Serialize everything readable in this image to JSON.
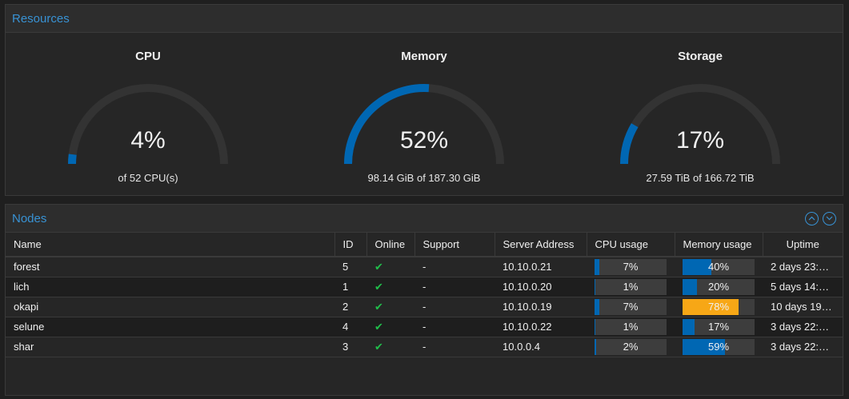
{
  "colors": {
    "accent": "#3892d4",
    "gauge_fill": "#0067b3",
    "gauge_track": "#333333",
    "bar_warn": "#f7a716",
    "online_check": "#21bf4b"
  },
  "resources": {
    "title": "Resources",
    "gauges": [
      {
        "title": "CPU",
        "value": 4,
        "value_label": "4%",
        "sub": "of 52 CPU(s)"
      },
      {
        "title": "Memory",
        "value": 52,
        "value_label": "52%",
        "sub": "98.14 GiB of 187.30 GiB"
      },
      {
        "title": "Storage",
        "value": 17,
        "value_label": "17%",
        "sub": "27.59 TiB of 166.72 TiB"
      }
    ]
  },
  "nodes": {
    "title": "Nodes",
    "tools": {
      "collapse_icon": "chevron-up-circle-icon",
      "expand_icon": "chevron-down-circle-icon"
    },
    "columns": [
      "Name",
      "ID",
      "Online",
      "Support",
      "Server Address",
      "CPU usage",
      "Memory usage",
      "Uptime"
    ],
    "rows": [
      {
        "name": "forest",
        "id": "5",
        "online": "✔",
        "support": "-",
        "address": "10.10.0.21",
        "cpu": 7,
        "cpu_label": "7%",
        "mem": 40,
        "mem_label": "40%",
        "uptime": "2 days 23:…"
      },
      {
        "name": "lich",
        "id": "1",
        "online": "✔",
        "support": "-",
        "address": "10.10.0.20",
        "cpu": 1,
        "cpu_label": "1%",
        "mem": 20,
        "mem_label": "20%",
        "uptime": "5 days 14:…"
      },
      {
        "name": "okapi",
        "id": "2",
        "online": "✔",
        "support": "-",
        "address": "10.10.0.19",
        "cpu": 7,
        "cpu_label": "7%",
        "mem": 78,
        "mem_label": "78%",
        "uptime": "10 days 19…"
      },
      {
        "name": "selune",
        "id": "4",
        "online": "✔",
        "support": "-",
        "address": "10.10.0.22",
        "cpu": 1,
        "cpu_label": "1%",
        "mem": 17,
        "mem_label": "17%",
        "uptime": "3 days 22:…"
      },
      {
        "name": "shar",
        "id": "3",
        "online": "✔",
        "support": "-",
        "address": "10.0.0.4",
        "cpu": 2,
        "cpu_label": "2%",
        "mem": 59,
        "mem_label": "59%",
        "uptime": "3 days 22:…"
      }
    ]
  }
}
